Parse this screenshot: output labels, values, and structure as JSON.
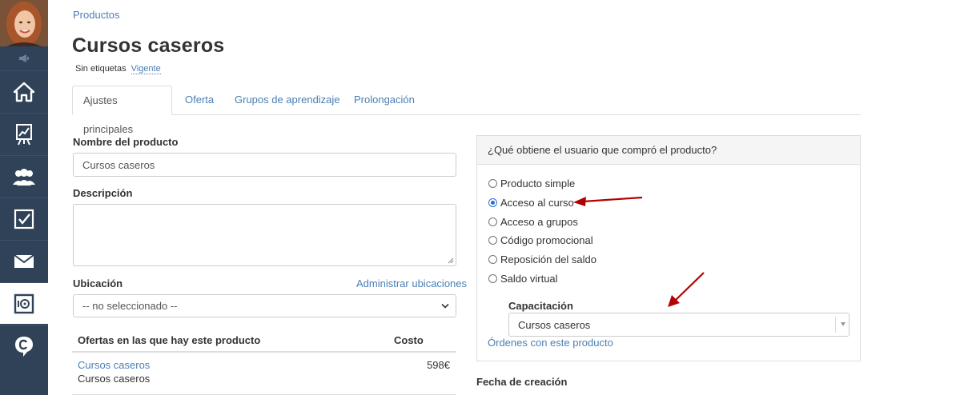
{
  "sidebar": {
    "avatar_alt": "user-avatar",
    "items": [
      {
        "name": "home"
      },
      {
        "name": "stats"
      },
      {
        "name": "users"
      },
      {
        "name": "tasks"
      },
      {
        "name": "messages"
      },
      {
        "name": "safe",
        "active": true
      },
      {
        "name": "chat"
      }
    ]
  },
  "breadcrumb": "Productos",
  "title": "Cursos caseros",
  "tags": {
    "label": "Sin etiquetas",
    "status": "Vigente"
  },
  "tabs": [
    {
      "label": "Ajustes principales",
      "active": true
    },
    {
      "label": "Oferta"
    },
    {
      "label": "Grupos de aprendizaje"
    },
    {
      "label": "Prolongación"
    }
  ],
  "form": {
    "name_label": "Nombre del producto",
    "name_value": "Cursos caseros",
    "description_label": "Descripción",
    "location_label": "Ubicación",
    "manage_locations": "Administrar ubicaciones",
    "location_value": "-- no seleccionado --"
  },
  "offers": {
    "col_name": "Ofertas en las que hay este producto",
    "col_cost": "Costo",
    "rows": [
      {
        "name": "Cursos caseros",
        "sub": "Cursos caseros",
        "price": "598€"
      }
    ]
  },
  "panel": {
    "question": "¿Qué obtiene el usuario que compró el producto?",
    "options": [
      {
        "label": "Producto simple",
        "checked": false
      },
      {
        "label": "Acceso al curso",
        "checked": true
      },
      {
        "label": "Acceso a grupos",
        "checked": false
      },
      {
        "label": "Código promocional",
        "checked": false
      },
      {
        "label": "Reposición del saldo",
        "checked": false
      },
      {
        "label": "Saldo virtual",
        "checked": false
      }
    ],
    "capacitacion_label": "Capacitación",
    "capacitacion_value": "Cursos caseros",
    "orders_link": "Órdenes con este producto"
  },
  "creation_date_label": "Fecha de creación",
  "colors": {
    "sidebar": "#2f4258",
    "link": "#4a7fb5",
    "annotation_arrow": "#b30000"
  }
}
